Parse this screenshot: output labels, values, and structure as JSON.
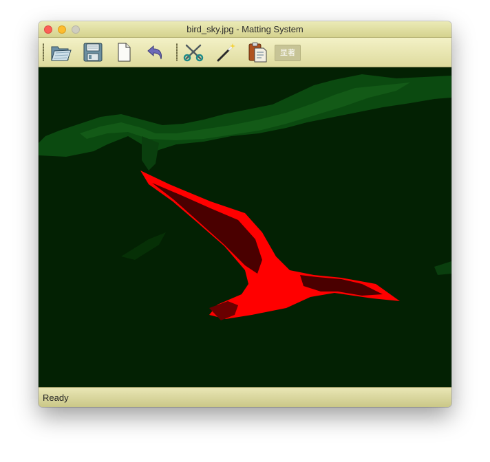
{
  "window": {
    "title": "bird_sky.jpg - Matting System"
  },
  "toolbar": {
    "buttons": [
      {
        "name": "open",
        "icon": "folder-open-icon"
      },
      {
        "name": "save",
        "icon": "floppy-disk-icon"
      },
      {
        "name": "new",
        "icon": "blank-document-icon"
      },
      {
        "name": "undo",
        "icon": "undo-arrow-icon"
      },
      {
        "name": "cut",
        "icon": "scissors-icon"
      },
      {
        "name": "magic-wand",
        "icon": "magic-wand-icon"
      },
      {
        "name": "export",
        "icon": "clipboard-export-icon"
      }
    ],
    "text_button_label": "显著"
  },
  "canvas": {
    "image": "matting preview: bird highlighted in red on dark green background",
    "colors": {
      "background": "#032103",
      "cloud": "#0b4a10",
      "foreground": "#ff0000",
      "foreground_dark": "#4a0000"
    }
  },
  "status": {
    "text": "Ready"
  }
}
